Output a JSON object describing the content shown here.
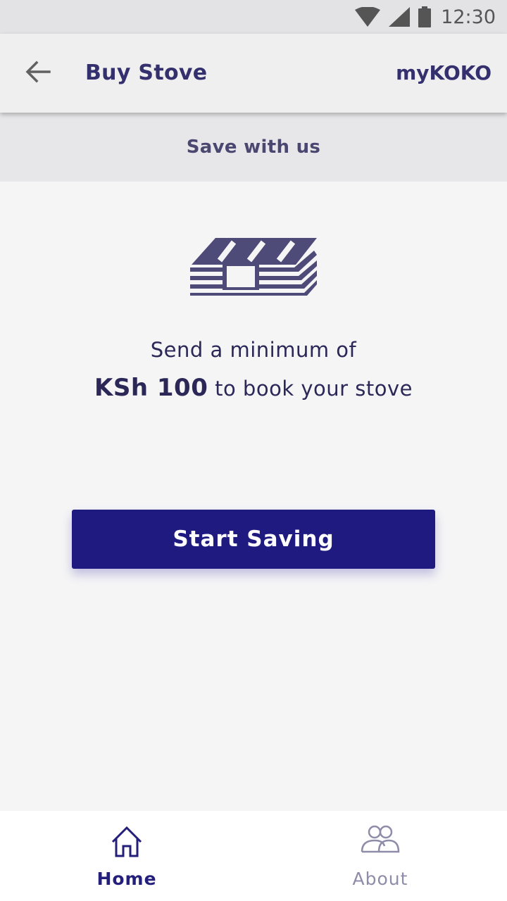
{
  "status_bar": {
    "time": "12:30",
    "icons": [
      "wifi-icon",
      "signal-icon",
      "battery-icon"
    ]
  },
  "app_bar": {
    "back_icon": "arrow-left-icon",
    "title": "Buy Stove",
    "brand": "myKOKO"
  },
  "sub_header": {
    "text": "Save with us"
  },
  "main": {
    "icon": "money-stack-icon",
    "line1": "Send a minimum of",
    "amount": "KSh 100",
    "line2_rest": " to book your stove",
    "button_label": "Start Saving"
  },
  "bottom_nav": {
    "items": [
      {
        "label": "Home",
        "icon": "home-icon",
        "active": true
      },
      {
        "label": "About",
        "icon": "people-icon",
        "active": false
      }
    ]
  },
  "colors": {
    "primary": "#1e1a80",
    "title_text": "#34306e",
    "icon": "#4f4b78",
    "inactive": "#8e8ca8"
  }
}
